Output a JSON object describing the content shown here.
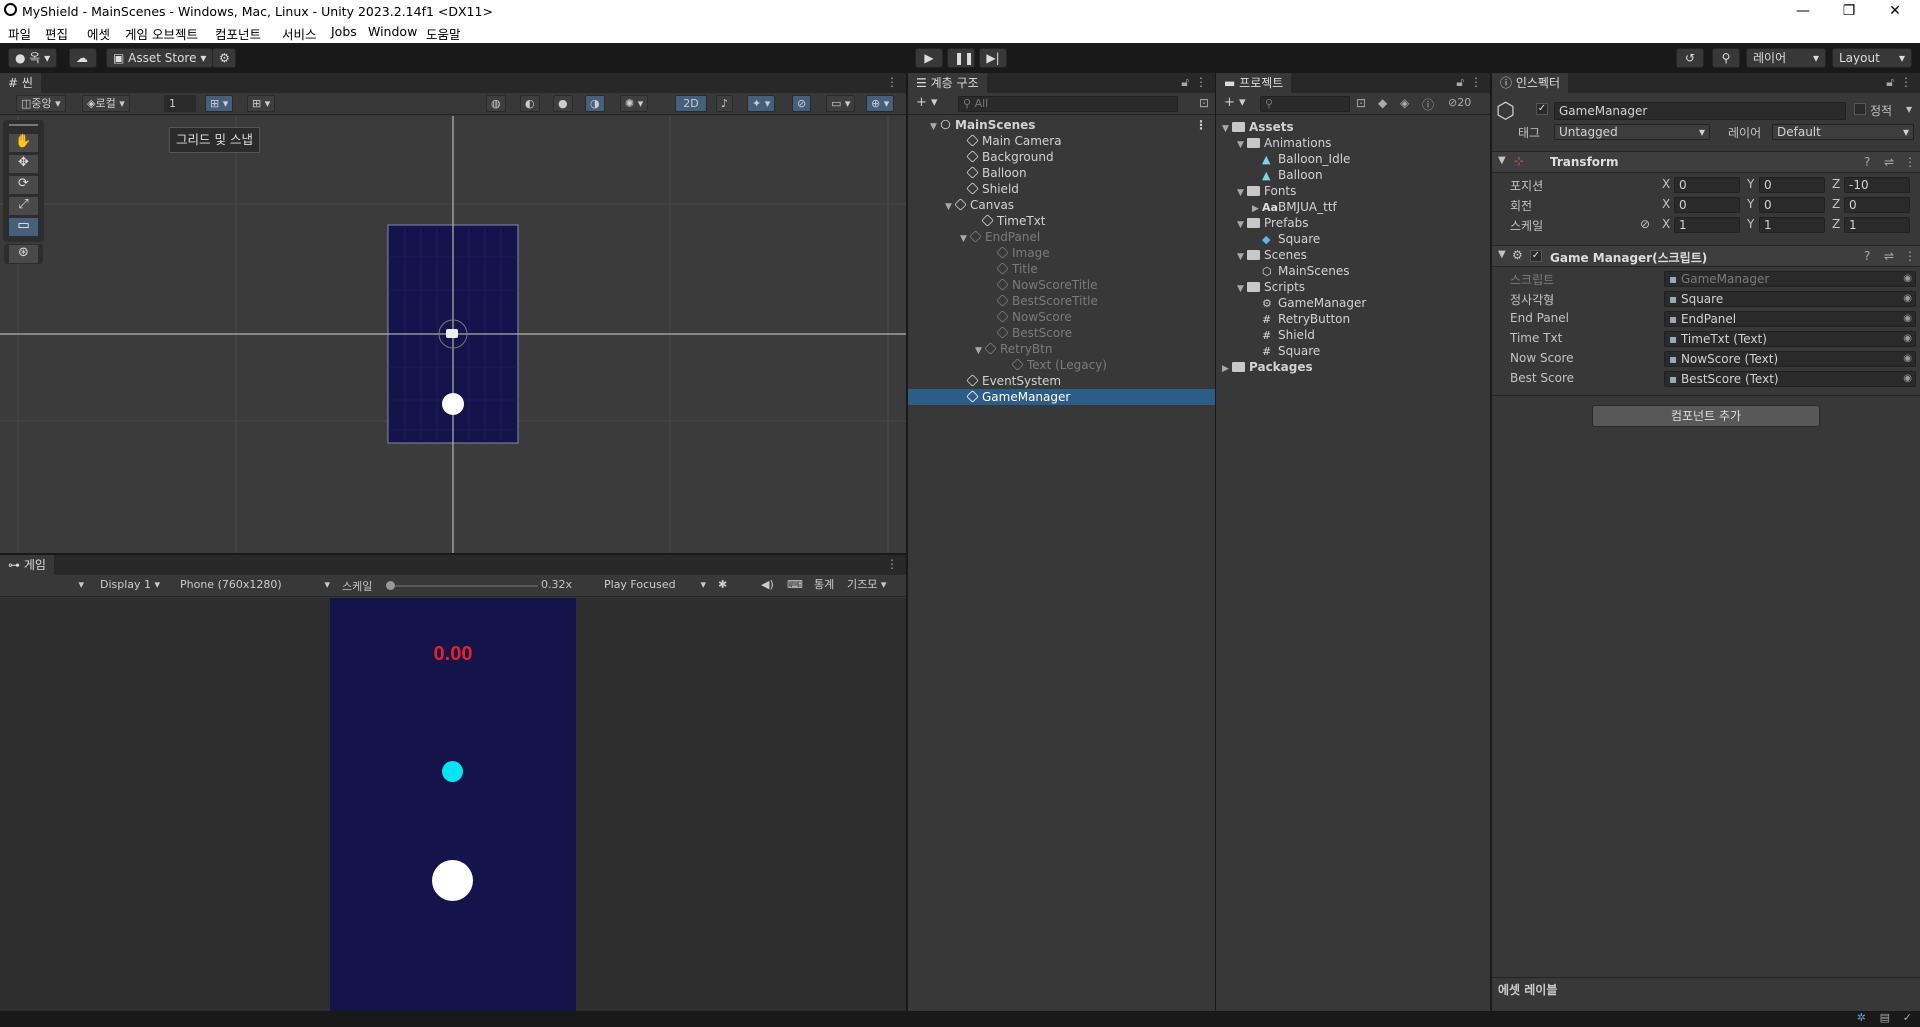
{
  "window": {
    "title": "MyShield - MainScenes - Windows, Mac, Linux - Unity 2023.2.14f1 <DX11>",
    "minimize": "—",
    "maximize": "❐",
    "close": "✕"
  },
  "menu": [
    "파일",
    "편집",
    "에셋",
    "게임 오브젝트",
    "컴포넌트",
    "서비스",
    "Jobs",
    "Window",
    "도움말"
  ],
  "toolbar": {
    "account": "옥",
    "asset_store": "Asset Store",
    "layers": "레이어",
    "layout": "Layout"
  },
  "scene": {
    "tab": "씬",
    "pivot": "중앙",
    "space": "로컬",
    "snap_value": "1",
    "mode_2d": "2D",
    "tooltip": "그리드 및 스냅"
  },
  "game": {
    "tab": "게임",
    "display": "Display 1",
    "resolution": "Phone (760x1280)",
    "scale_label": "스케일",
    "scale_value": "0.32x",
    "play_mode": "Play Focused",
    "stats": "통계",
    "gizmos": "기즈모",
    "timer": "0.00",
    "colors": {
      "background": "#14134a",
      "timer": "#e8202a",
      "shield": "#00e5ef",
      "ball": "#ffffff"
    }
  },
  "hierarchy": {
    "tab": "계층 구조",
    "search_placeholder": "All",
    "items": [
      {
        "label": "MainScenes",
        "depth": 0,
        "style": "scene"
      },
      {
        "label": "Main Camera",
        "depth": 1
      },
      {
        "label": "Background",
        "depth": 1
      },
      {
        "label": "Balloon",
        "depth": 1
      },
      {
        "label": "Shield",
        "depth": 1
      },
      {
        "label": "Canvas",
        "depth": 1,
        "expanded": true
      },
      {
        "label": "TimeTxt",
        "depth": 2
      },
      {
        "label": "EndPanel",
        "depth": 2,
        "expanded": true,
        "dim": true
      },
      {
        "label": "Image",
        "depth": 3,
        "dim": true
      },
      {
        "label": "Title",
        "depth": 3,
        "dim": true
      },
      {
        "label": "NowScoreTitle",
        "depth": 3,
        "dim": true
      },
      {
        "label": "BestScoreTitle",
        "depth": 3,
        "dim": true
      },
      {
        "label": "NowScore",
        "depth": 3,
        "dim": true
      },
      {
        "label": "BestScore",
        "depth": 3,
        "dim": true
      },
      {
        "label": "RetryBtn",
        "depth": 3,
        "expanded": true,
        "dim": true
      },
      {
        "label": "Text (Legacy)",
        "depth": 4,
        "dim": true
      },
      {
        "label": "EventSystem",
        "depth": 1
      },
      {
        "label": "GameManager",
        "depth": 1,
        "selected": true
      }
    ]
  },
  "project": {
    "tab": "프로젝트",
    "hidden_count": "20",
    "items": [
      {
        "label": "Assets",
        "depth": 0,
        "type": "folder",
        "expanded": true,
        "bold": true
      },
      {
        "label": "Animations",
        "depth": 1,
        "type": "folder",
        "expanded": true
      },
      {
        "label": "Balloon_Idle",
        "depth": 2,
        "type": "anim"
      },
      {
        "label": "Balloon",
        "depth": 2,
        "type": "anim"
      },
      {
        "label": "Fonts",
        "depth": 1,
        "type": "folder",
        "expanded": true
      },
      {
        "label": "BMJUA_ttf",
        "depth": 2,
        "type": "font",
        "collapsed": true
      },
      {
        "label": "Prefabs",
        "depth": 1,
        "type": "folder",
        "expanded": true
      },
      {
        "label": "Square",
        "depth": 2,
        "type": "prefab"
      },
      {
        "label": "Scenes",
        "depth": 1,
        "type": "folder",
        "expanded": true
      },
      {
        "label": "MainScenes",
        "depth": 2,
        "type": "scene"
      },
      {
        "label": "Scripts",
        "depth": 1,
        "type": "folder",
        "expanded": true
      },
      {
        "label": "GameManager",
        "depth": 2,
        "type": "gear"
      },
      {
        "label": "RetryButton",
        "depth": 2,
        "type": "script"
      },
      {
        "label": "Shield",
        "depth": 2,
        "type": "script"
      },
      {
        "label": "Square",
        "depth": 2,
        "type": "script"
      },
      {
        "label": "Packages",
        "depth": 0,
        "type": "folder",
        "collapsed": true,
        "bold": true
      }
    ]
  },
  "inspector": {
    "tab": "인스펙터",
    "object_name": "GameManager",
    "static_label": "정적",
    "tag_label": "태그",
    "tag_value": "Untagged",
    "layer_label": "레이어",
    "layer_value": "Default",
    "transform": {
      "title": "Transform",
      "rows": [
        {
          "label": "포지션",
          "x": "0",
          "y": "0",
          "z": "-10"
        },
        {
          "label": "회전",
          "x": "0",
          "y": "0",
          "z": "0"
        },
        {
          "label": "스케일",
          "x": "1",
          "y": "1",
          "z": "1"
        }
      ]
    },
    "component": {
      "title": "Game Manager(스크립트)",
      "fields": [
        {
          "label": "스크립트",
          "value": "GameManager",
          "dim": true
        },
        {
          "label": "정사각형",
          "value": "Square"
        },
        {
          "label": "End Panel",
          "value": "EndPanel"
        },
        {
          "label": "Time Txt",
          "value": "TimeTxt (Text)"
        },
        {
          "label": "Now Score",
          "value": "NowScore (Text)"
        },
        {
          "label": "Best Score",
          "value": "BestScore (Text)"
        }
      ]
    },
    "add_component": "컴포넌트 추가",
    "asset_labels": "에셋 레이블"
  }
}
